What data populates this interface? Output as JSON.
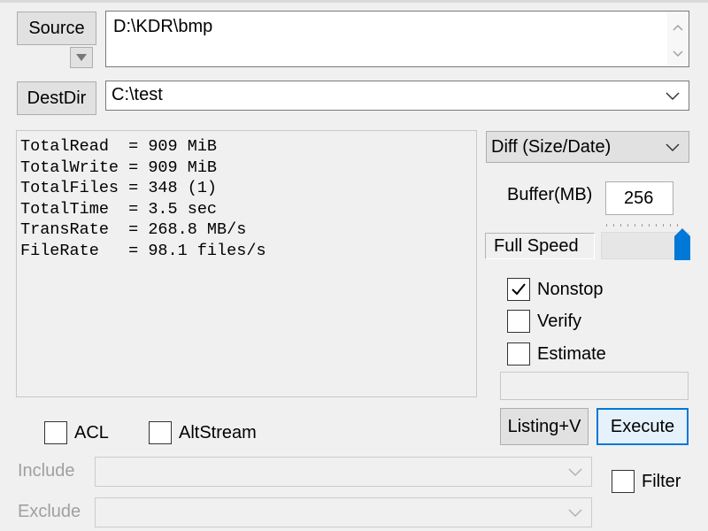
{
  "source": {
    "button_label": "Source",
    "path_value": "D:\\KDR\\bmp"
  },
  "dest": {
    "button_label": "DestDir",
    "path_value": "C:\\test"
  },
  "log": {
    "lines": [
      "TotalRead  = 909 MiB",
      "TotalWrite = 909 MiB",
      "TotalFiles = 348 (1)",
      "TotalTime  = 3.5 sec",
      "TransRate  = 268.8 MB/s",
      "FileRate   = 98.1 files/s"
    ]
  },
  "mode": {
    "selected": "Diff (Size/Date)"
  },
  "buffer": {
    "label": "Buffer(MB)",
    "value": "256"
  },
  "speed": {
    "label": "Full Speed",
    "level_fraction": 1.0
  },
  "options": {
    "nonstop": {
      "label": "Nonstop",
      "checked": true
    },
    "verify": {
      "label": "Verify",
      "checked": false
    },
    "estimate": {
      "label": "Estimate",
      "checked": false
    },
    "acl": {
      "label": "ACL",
      "checked": false
    },
    "altstream": {
      "label": "AltStream",
      "checked": false
    },
    "filter": {
      "label": "Filter",
      "checked": false
    }
  },
  "actions": {
    "listing_label": "Listing+V",
    "execute_label": "Execute"
  },
  "filters": {
    "include_label": "Include",
    "exclude_label": "Exclude"
  },
  "icons": {
    "dropdown": "chevron-down-icon",
    "checkmark": "checkmark-icon",
    "history": "triangle-down-icon"
  }
}
